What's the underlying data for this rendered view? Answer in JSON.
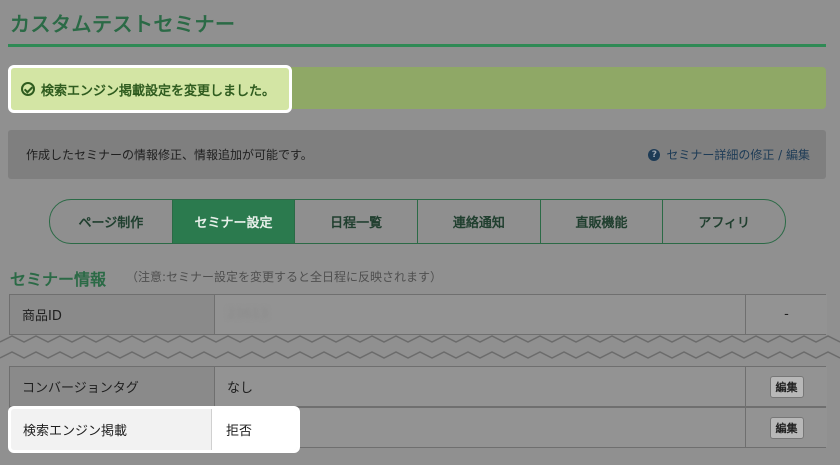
{
  "page": {
    "title": "カスタムテストセミナー"
  },
  "notice": {
    "icon": "check-circle-icon",
    "text": "検索エンジン掲載設定を変更しました。"
  },
  "info": {
    "text": "作成したセミナーの情報修正、情報追加が可能です。",
    "help_icon": "question-circle-icon",
    "help_mark": "?",
    "link_text": "セミナー詳細の修正 / 編集"
  },
  "tabs": [
    {
      "label": "ページ制作",
      "active": false
    },
    {
      "label": "セミナー設定",
      "active": true
    },
    {
      "label": "日程一覧",
      "active": false
    },
    {
      "label": "連絡通知",
      "active": false
    },
    {
      "label": "直販機能",
      "active": false
    },
    {
      "label": "アフィリ",
      "active": false
    }
  ],
  "section": {
    "title": "セミナー情報",
    "note": "（注意:セミナー設定を変更すると全日程に反映されます）"
  },
  "table": {
    "rows": [
      {
        "label": "商品ID",
        "value": "23613",
        "action": "-"
      },
      {
        "label": "コンバージョンタグ",
        "value": "なし",
        "action": "編集"
      },
      {
        "label": "検索エンジン掲載",
        "value": "拒否",
        "action": "編集"
      }
    ]
  },
  "colors": {
    "brand_green": "#2b6a46",
    "notice_green": "#d3e5a4"
  }
}
